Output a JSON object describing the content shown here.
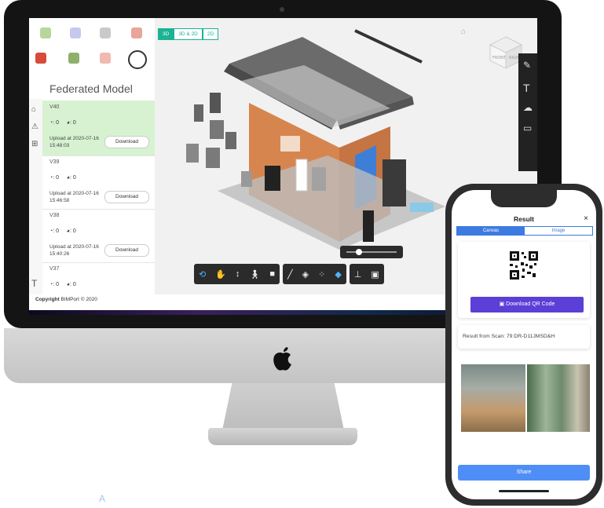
{
  "sidebar": {
    "title": "Federated Model",
    "versions": [
      {
        "name": "V40",
        "stat1": ": 0",
        "stat2": ": 0",
        "upload": "Upload at 2020-07-16 15:48:03",
        "download": "Download"
      },
      {
        "name": "V39",
        "stat1": ": 0",
        "stat2": ": 0",
        "upload": "Upload at 2020-07-16 15:46:58",
        "download": "Download"
      },
      {
        "name": "V38",
        "stat1": ": 0",
        "stat2": ": 0",
        "upload": "Upload at 2020-07-16 15:40:26",
        "download": "Download"
      },
      {
        "name": "V37",
        "stat1": ": 0",
        "stat2": ": 0"
      }
    ],
    "copyright_bold": "Copyright",
    "copyright_rest": " BIMPort © 2020"
  },
  "viewport": {
    "tabs": [
      "3D",
      "3D & 2D",
      "2D"
    ],
    "cube_front": "FRONT",
    "cube_right": "RIGHT"
  },
  "phone": {
    "title": "Result",
    "close": "×",
    "tabs": [
      "Canvas",
      "Image"
    ],
    "qr_button": "Download QR Code",
    "scan_result": "Result from Scan: 79:DR-D11JMSD&H",
    "share": "Share"
  },
  "colors": {
    "accent_green": "#1ab394",
    "active_row": "#d7f2d1",
    "qr_button": "#5b3fd6",
    "share_button": "#4f8ef7"
  }
}
